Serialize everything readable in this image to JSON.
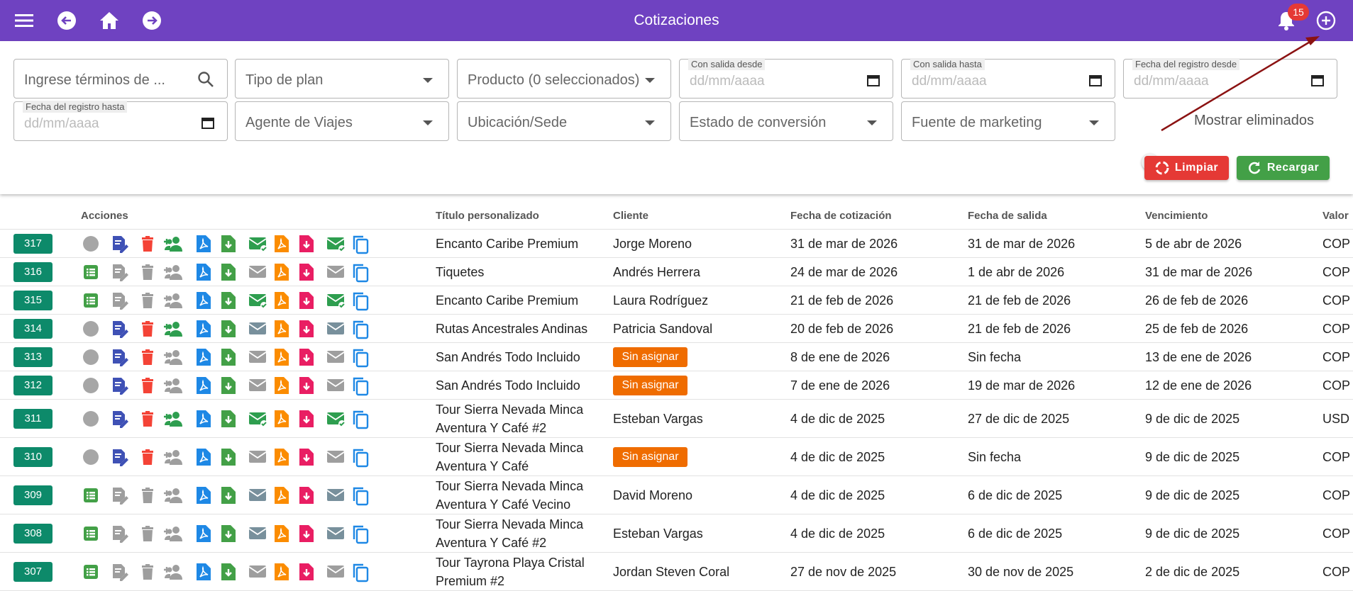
{
  "header": {
    "title": "Cotizaciones",
    "notifications_count": "15",
    "icons": [
      "menu-icon",
      "back-icon",
      "home-icon",
      "forward-icon",
      "bell-icon",
      "add-icon"
    ]
  },
  "filters": {
    "search": {
      "placeholder": "Ingrese términos de ..."
    },
    "plan_type": "Tipo de plan",
    "product": "Producto (0 seleccionados)",
    "departure_from": {
      "label": "Con salida desde",
      "placeholder": "dd/mm/aaaa"
    },
    "departure_to": {
      "label": "Con salida hasta",
      "placeholder": "dd/mm/aaaa"
    },
    "registered_from": {
      "label": "Fecha del registro desde",
      "placeholder": "dd/mm/aaaa"
    },
    "registered_to": {
      "label": "Fecha del registro hasta",
      "placeholder": "dd/mm/aaaa"
    },
    "agent": "Agente de Viajes",
    "location": "Ubicación/Sede",
    "conversion": "Estado de conversión",
    "marketing": "Fuente de marketing",
    "show_deleted": "Mostrar eliminados",
    "show_deleted_on": false,
    "clear": "Limpiar",
    "reload": "Recargar"
  },
  "table": {
    "headers": {
      "actions": "Acciones",
      "title": "Título personalizado",
      "client": "Cliente",
      "quote_date": "Fecha de cotización",
      "departure": "Fecha de salida",
      "expiry": "Vencimiento",
      "value": "Valor"
    },
    "rows": [
      {
        "id": "317",
        "title": [
          "Encanto Caribe Premium"
        ],
        "client": "Jorge Moreno",
        "quote_date": "31 de mar de 2026",
        "departure": "31 de mar de 2026",
        "expiry": "5 de abr de 2026",
        "currency": "COP"
      },
      {
        "id": "316",
        "title": [
          "Tiquetes"
        ],
        "client": "Andrés Herrera",
        "quote_date": "24 de mar de 2026",
        "departure": "1 de abr de 2026",
        "expiry": "31 de mar de 2026",
        "currency": "COP"
      },
      {
        "id": "315",
        "title": [
          "Encanto Caribe Premium"
        ],
        "client": "Laura Rodríguez",
        "quote_date": "21 de feb de 2026",
        "departure": "21 de feb de 2026",
        "expiry": "26 de feb de 2026",
        "currency": "COP"
      },
      {
        "id": "314",
        "title": [
          "Rutas Ancestrales Andinas"
        ],
        "client": "Patricia Sandoval",
        "quote_date": "20 de feb de 2026",
        "departure": "21 de feb de 2026",
        "expiry": "25 de feb de 2026",
        "currency": "COP"
      },
      {
        "id": "313",
        "title": [
          "San Andrés Todo Incluido"
        ],
        "client": "Sin asignar",
        "unassigned": true,
        "quote_date": "8 de ene de 2026",
        "departure": "Sin fecha",
        "expiry": "13 de ene de 2026",
        "currency": "COP"
      },
      {
        "id": "312",
        "title": [
          "San Andrés Todo Incluido"
        ],
        "client": "Sin asignar",
        "unassigned": true,
        "quote_date": "7 de ene de 2026",
        "departure": "19 de mar de 2026",
        "expiry": "12 de ene de 2026",
        "currency": "COP"
      },
      {
        "id": "311",
        "title": [
          "Tour Sierra Nevada Minca",
          "Aventura Y Café #2"
        ],
        "client": "Esteban Vargas",
        "quote_date": "4 de dic de 2025",
        "departure": "27 de dic de 2025",
        "expiry": "9 de dic de 2025",
        "currency": "USD"
      },
      {
        "id": "310",
        "title": [
          "Tour Sierra Nevada Minca",
          "Aventura Y Café"
        ],
        "client": "Sin asignar",
        "unassigned": true,
        "quote_date": "4 de dic de 2025",
        "departure": "Sin fecha",
        "expiry": "9 de dic de 2025",
        "currency": "COP"
      },
      {
        "id": "309",
        "title": [
          "Tour Sierra Nevada Minca",
          "Aventura Y Café Vecino"
        ],
        "client": "David Moreno",
        "quote_date": "4 de dic de 2025",
        "departure": "6 de dic de 2025",
        "expiry": "9 de dic de 2025",
        "currency": "COP"
      },
      {
        "id": "308",
        "title": [
          "Tour Sierra Nevada Minca",
          "Aventura Y Café #2"
        ],
        "client": "Esteban Vargas",
        "quote_date": "4 de dic de 2025",
        "departure": "6 de dic de 2025",
        "expiry": "9 de dic de 2025",
        "currency": "COP"
      },
      {
        "id": "307",
        "title": [
          "Tour Tayrona Playa Cristal",
          "Premium #2"
        ],
        "client": "Jordan Steven Coral",
        "quote_date": "27 de nov de 2025",
        "departure": "30 de nov de 2025",
        "expiry": "2 de dic de 2025",
        "currency": "COP"
      }
    ]
  },
  "row_actions": [
    {
      "state": "circle-icon",
      "edit": "#3f51b5",
      "del": "#f44336",
      "team": "#2e9e4f",
      "email": "#2e9e4f",
      "email_check": true
    },
    {
      "state": "list-icon",
      "edit": "#9e9e9e",
      "del": "#9e9e9e",
      "team": "#9e9e9e",
      "email": "#9e9e9e",
      "email_check": false
    },
    {
      "state": "list-icon",
      "edit": "#9e9e9e",
      "del": "#9e9e9e",
      "team": "#9e9e9e",
      "email": "#2e9e4f",
      "email_check": true
    },
    {
      "state": "circle-icon",
      "edit": "#3f51b5",
      "del": "#f44336",
      "team": "#2e9e4f",
      "email": "#78909c",
      "email_check": false
    },
    {
      "state": "circle-icon",
      "edit": "#3f51b5",
      "del": "#f44336",
      "team": "#9e9e9e",
      "email": "#9e9e9e",
      "email_check": false
    },
    {
      "state": "circle-icon",
      "edit": "#3f51b5",
      "del": "#f44336",
      "team": "#9e9e9e",
      "email": "#9e9e9e",
      "email_check": false
    },
    {
      "state": "circle-icon",
      "edit": "#3f51b5",
      "del": "#f44336",
      "team": "#2e9e4f",
      "email": "#2e9e4f",
      "email_check": true
    },
    {
      "state": "circle-icon",
      "edit": "#3f51b5",
      "del": "#f44336",
      "team": "#9e9e9e",
      "email": "#9e9e9e",
      "email_check": false
    },
    {
      "state": "list-icon",
      "edit": "#9e9e9e",
      "del": "#9e9e9e",
      "team": "#9e9e9e",
      "email": "#78909c",
      "email_check": false
    },
    {
      "state": "list-icon",
      "edit": "#9e9e9e",
      "del": "#9e9e9e",
      "team": "#9e9e9e",
      "email": "#78909c",
      "email_check": false
    },
    {
      "state": "list-icon",
      "edit": "#9e9e9e",
      "del": "#9e9e9e",
      "team": "#9e9e9e",
      "email": "#9e9e9e",
      "email_check": false
    }
  ],
  "colors": {
    "header": "#6f42c1",
    "id_badge": "#0d8a6a",
    "unassigned": "#ef6c00",
    "pdf_blue": "#1e88e5",
    "pdf_orange": "#fb8c00",
    "download_green": "#43a047",
    "download_pink": "#e91e63",
    "copy": "#1e88e5"
  }
}
